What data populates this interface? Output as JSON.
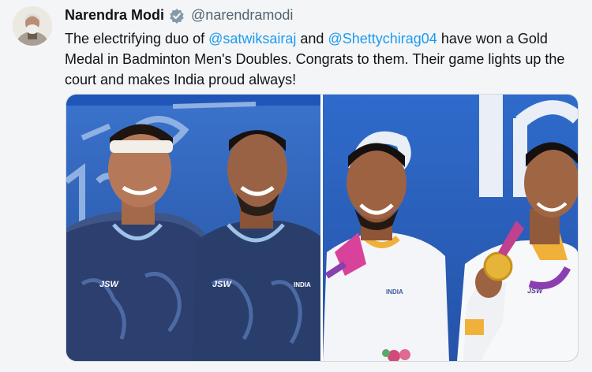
{
  "tweet": {
    "author": {
      "name": "Narendra Modi",
      "handle": "@narendramodi",
      "verified": true
    },
    "text": {
      "part1": "The electrifying duo of ",
      "mention1": "@satwiksairaj",
      "part2": " and ",
      "mention2": "@Shettychirag04",
      "part3": " have won a Gold Medal in Badminton Men's Doubles. Congrats to them. Their game lights up the court and makes India proud always!"
    },
    "media": {
      "left_jersey_brand": "JSW",
      "left_jersey_brand_2": "JSW",
      "left_jersey_country": "INDIA",
      "right_jersey_country": "INDIA",
      "right_medal_brand": "JSW"
    }
  },
  "colors": {
    "mention": "#1d9bf0",
    "verified_badge": "#829aab",
    "backdrop_blue": "#2f68c4"
  }
}
